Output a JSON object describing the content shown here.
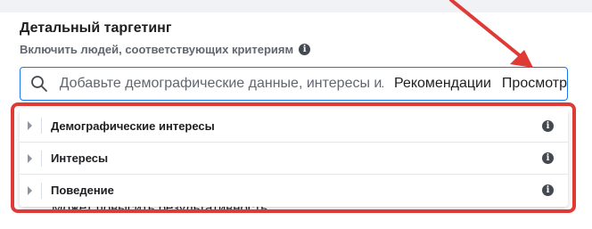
{
  "targeting": {
    "title": "Детальный таргетинг",
    "subtitle": "Включить людей, соответствующих критериям"
  },
  "search": {
    "placeholder": "Добавьте демографические данные, интересы ил",
    "recommendations_label": "Рекомендации",
    "browse_label": "Просмотр"
  },
  "dropdown": {
    "items": [
      {
        "label": "Демографические интересы"
      },
      {
        "label": "Интересы"
      },
      {
        "label": "Поведение"
      }
    ]
  },
  "background_text": "Может повысить результативность.",
  "colors": {
    "accent": "#1877f2",
    "annotation_red": "#e03a36"
  }
}
